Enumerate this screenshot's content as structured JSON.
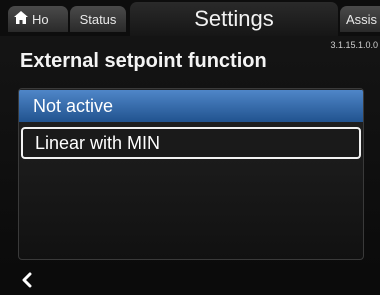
{
  "tabs": {
    "home_label": "Ho",
    "status_label": "Status",
    "settings_label": "Settings",
    "assist_label": "Assis"
  },
  "version": "3.1.15.1.0.0",
  "page": {
    "title": "External setpoint function"
  },
  "list": {
    "items": [
      {
        "label": "Not active",
        "state": "highlighted"
      },
      {
        "label": "Linear with MIN",
        "state": "focused"
      }
    ]
  },
  "nav": {
    "back_icon": "chevron-left-icon"
  },
  "colors": {
    "highlight": "#3b73b8",
    "background": "#0c0c0c",
    "text": "#ffffff"
  }
}
